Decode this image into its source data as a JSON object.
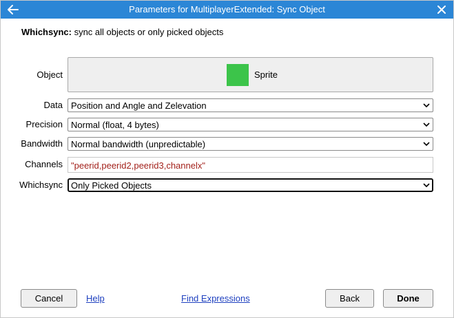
{
  "window": {
    "title": "Parameters for MultiplayerExtended: Sync Object",
    "colors": {
      "titlebar": "#2b86d6",
      "object_swatch": "#3cc44a",
      "expression_text": "#a3221c",
      "link": "#1d3fbf"
    }
  },
  "description": {
    "param_name": "Whichsync:",
    "text": " sync all objects or only picked objects"
  },
  "params": {
    "object": {
      "label": "Object",
      "value": "Sprite",
      "icon": "green-square-sprite-icon"
    },
    "data": {
      "label": "Data",
      "value": "Position and Angle and Zelevation"
    },
    "precision": {
      "label": "Precision",
      "value": "Normal (float, 4 bytes)"
    },
    "bandwidth": {
      "label": "Bandwidth",
      "value": "Normal bandwidth (unpredictable)"
    },
    "channels": {
      "label": "Channels",
      "value": "\"peerid,peerid2,peerid3,channelx\""
    },
    "whichsync": {
      "label": "Whichsync",
      "value": "Only Picked Objects"
    }
  },
  "footer": {
    "cancel": "Cancel",
    "help": "Help",
    "find_expressions": "Find Expressions",
    "back": "Back",
    "done": "Done"
  }
}
